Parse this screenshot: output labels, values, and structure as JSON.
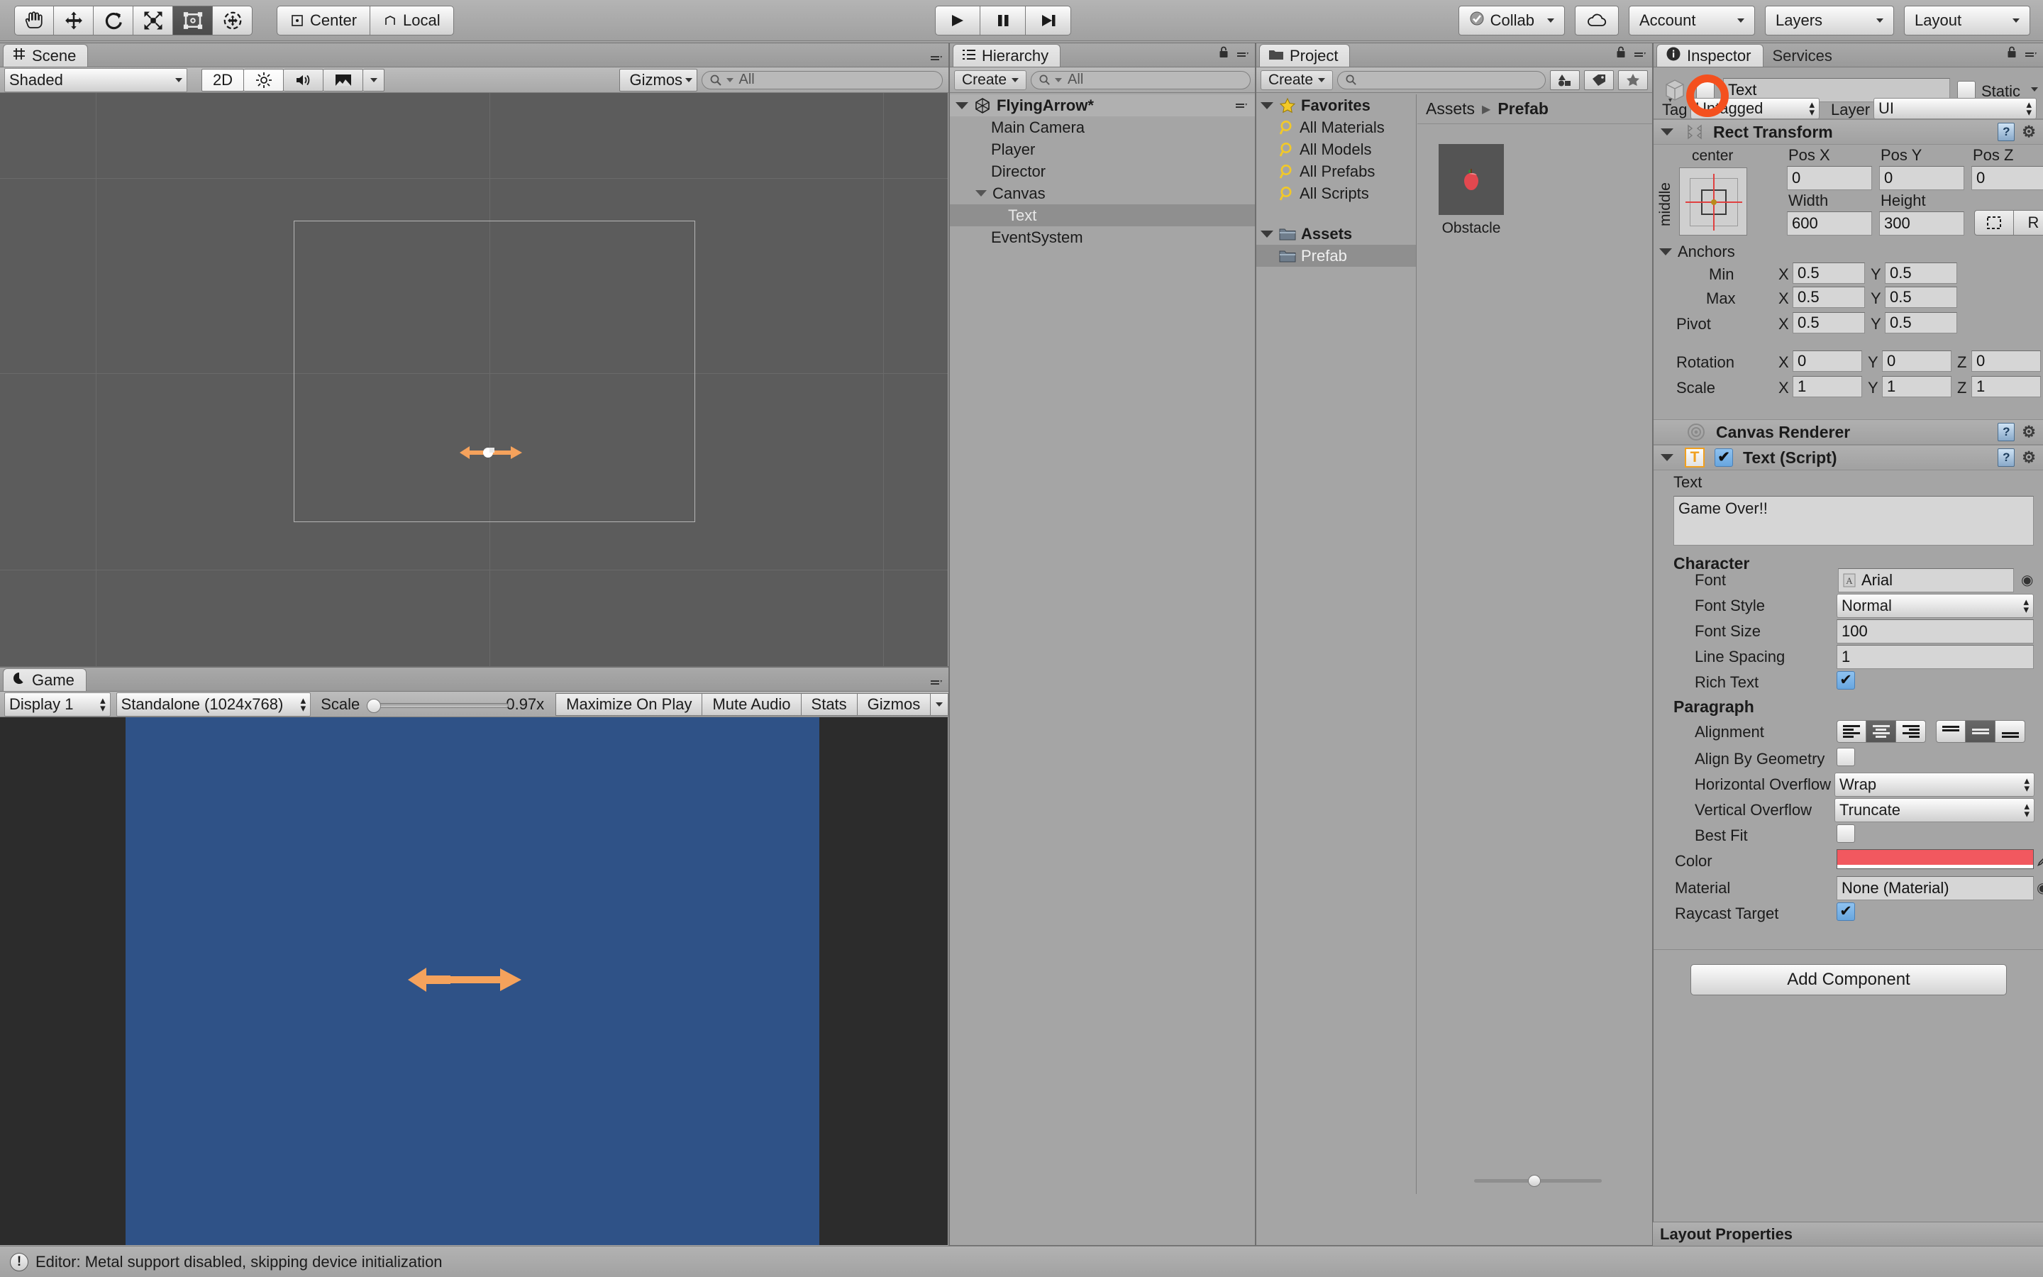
{
  "toolbar": {
    "tools": [
      {
        "name": "hand-tool",
        "icon": "hand",
        "active": false
      },
      {
        "name": "move-tool",
        "icon": "move",
        "active": false
      },
      {
        "name": "rotate-tool",
        "icon": "rotate",
        "active": false
      },
      {
        "name": "scale-tool",
        "icon": "scale",
        "active": false
      },
      {
        "name": "rect-tool",
        "icon": "rect",
        "active": true
      },
      {
        "name": "transform-tool",
        "icon": "transform",
        "active": false
      }
    ],
    "pivot_mode": "Center",
    "pivot_rotation": "Local",
    "play": "play-icon",
    "pause": "pause-icon",
    "step": "step-icon",
    "collab": "Collab",
    "cloud": "cloud-icon",
    "account": "Account",
    "layers": "Layers",
    "layout": "Layout"
  },
  "scene": {
    "tab": "Scene",
    "tab_icon": "grid-icon",
    "draw_mode": "Shaded",
    "mode_2d": "2D",
    "lighting_icon": "sun-icon",
    "audio_icon": "speaker-icon",
    "effects_icon": "image-icon",
    "gizmos": "Gizmos",
    "search_placeholder": "All"
  },
  "game": {
    "tab": "Game",
    "tab_icon": "gamepad-icon",
    "display": "Display 1",
    "aspect": "Standalone (1024x768)",
    "scale_label": "Scale",
    "scale_value": "0.97x",
    "maximize": "Maximize On Play",
    "mute": "Mute Audio",
    "stats": "Stats",
    "gizmos": "Gizmos",
    "bg_color": "#2f5287"
  },
  "hierarchy": {
    "tab": "Hierarchy",
    "tab_icon": "hierarchy-icon",
    "create": "Create",
    "search_placeholder": "All",
    "items": [
      {
        "label": "FlyingArrow*",
        "depth": 0,
        "expanded": true,
        "selected": false,
        "root": true,
        "icon": "unity-icon"
      },
      {
        "label": "Main Camera",
        "depth": 1,
        "expanded": false,
        "selected": false,
        "root": false,
        "icon": ""
      },
      {
        "label": "Player",
        "depth": 1,
        "expanded": false,
        "selected": false,
        "root": false,
        "icon": ""
      },
      {
        "label": "Director",
        "depth": 1,
        "expanded": false,
        "selected": false,
        "root": false,
        "icon": ""
      },
      {
        "label": "Canvas",
        "depth": 1,
        "expanded": true,
        "selected": false,
        "root": false,
        "icon": ""
      },
      {
        "label": "Text",
        "depth": 2,
        "expanded": false,
        "selected": true,
        "root": false,
        "icon": ""
      },
      {
        "label": "EventSystem",
        "depth": 1,
        "expanded": false,
        "selected": false,
        "root": false,
        "icon": ""
      }
    ]
  },
  "project": {
    "tab": "Project",
    "tab_icon": "folder-icon",
    "create": "Create",
    "search_placeholder": "",
    "tree": [
      {
        "label": "Favorites",
        "depth": 0,
        "icon": "star-icon",
        "bold": true,
        "expanded": true,
        "selected": false
      },
      {
        "label": "All Materials",
        "depth": 1,
        "icon": "search-icon",
        "bold": false,
        "expanded": false,
        "selected": false
      },
      {
        "label": "All Models",
        "depth": 1,
        "icon": "search-icon",
        "bold": false,
        "expanded": false,
        "selected": false
      },
      {
        "label": "All Prefabs",
        "depth": 1,
        "icon": "search-icon",
        "bold": false,
        "expanded": false,
        "selected": false
      },
      {
        "label": "All Scripts",
        "depth": 1,
        "icon": "search-icon",
        "bold": false,
        "expanded": false,
        "selected": false
      },
      {
        "label": "Assets",
        "depth": 0,
        "icon": "folder-icon",
        "bold": true,
        "expanded": true,
        "selected": false
      },
      {
        "label": "Prefab",
        "depth": 1,
        "icon": "folder-icon",
        "bold": false,
        "expanded": false,
        "selected": true
      }
    ],
    "breadcrumb": [
      "Assets",
      "Prefab"
    ],
    "assets": [
      {
        "label": "Obstacle",
        "icon": "apple-icon"
      }
    ]
  },
  "inspector": {
    "tabs": [
      {
        "label": "Inspector",
        "active": true,
        "icon": "info-icon"
      },
      {
        "label": "Services",
        "active": false,
        "icon": ""
      }
    ],
    "object_name": "Text",
    "active_checked": true,
    "static_label": "Static",
    "static_checked": false,
    "tag_label": "Tag",
    "tag_value": "Untagged",
    "layer_label": "Layer",
    "layer_value": "UI",
    "rect_transform": {
      "title": "Rect Transform",
      "anchor_preset_h": "center",
      "anchor_preset_v": "middle",
      "pos_x_label": "Pos X",
      "pos_x": "0",
      "pos_y_label": "Pos Y",
      "pos_y": "0",
      "pos_z_label": "Pos Z",
      "pos_z": "0",
      "width_label": "Width",
      "width": "600",
      "height_label": "Height",
      "height": "300",
      "blueprint_btn": "blueprint-icon",
      "raw_btn": "R",
      "anchors_label": "Anchors",
      "min_label": "Min",
      "min_x": "0.5",
      "min_y": "0.5",
      "max_label": "Max",
      "max_x": "0.5",
      "max_y": "0.5",
      "pivot_label": "Pivot",
      "pivot_x": "0.5",
      "pivot_y": "0.5",
      "rotation_label": "Rotation",
      "rot_x": "0",
      "rot_y": "0",
      "rot_z": "0",
      "scale_label": "Scale",
      "scale_x": "1",
      "scale_y": "1",
      "scale_z": "1",
      "x": "X",
      "y": "Y",
      "z": "Z"
    },
    "canvas_renderer": {
      "title": "Canvas Renderer"
    },
    "text_script": {
      "title": "Text (Script)",
      "enabled": true,
      "text_label": "Text",
      "text_value": "Game Over!!",
      "character_label": "Character",
      "font_label": "Font",
      "font_value": "Arial",
      "font_style_label": "Font Style",
      "font_style_value": "Normal",
      "font_size_label": "Font Size",
      "font_size_value": "100",
      "line_spacing_label": "Line Spacing",
      "line_spacing_value": "1",
      "rich_text_label": "Rich Text",
      "rich_text_checked": true,
      "paragraph_label": "Paragraph",
      "alignment_label": "Alignment",
      "align_h_selected": 1,
      "align_v_selected": 1,
      "align_by_geometry_label": "Align By Geometry",
      "align_by_geometry_checked": false,
      "horizontal_overflow_label": "Horizontal Overflow",
      "horizontal_overflow_value": "Wrap",
      "vertical_overflow_label": "Vertical Overflow",
      "vertical_overflow_value": "Truncate",
      "best_fit_label": "Best Fit",
      "best_fit_checked": false,
      "color_label": "Color",
      "color_value": "#f2585f",
      "material_label": "Material",
      "material_value": "None (Material)",
      "raycast_target_label": "Raycast Target",
      "raycast_target_checked": true
    },
    "add_component": "Add Component",
    "layout_properties": "Layout Properties"
  },
  "status": {
    "message": "Editor: Metal support disabled, skipping device initialization",
    "icon": "warning-icon"
  },
  "annotation": {
    "color": "#f4501e"
  }
}
